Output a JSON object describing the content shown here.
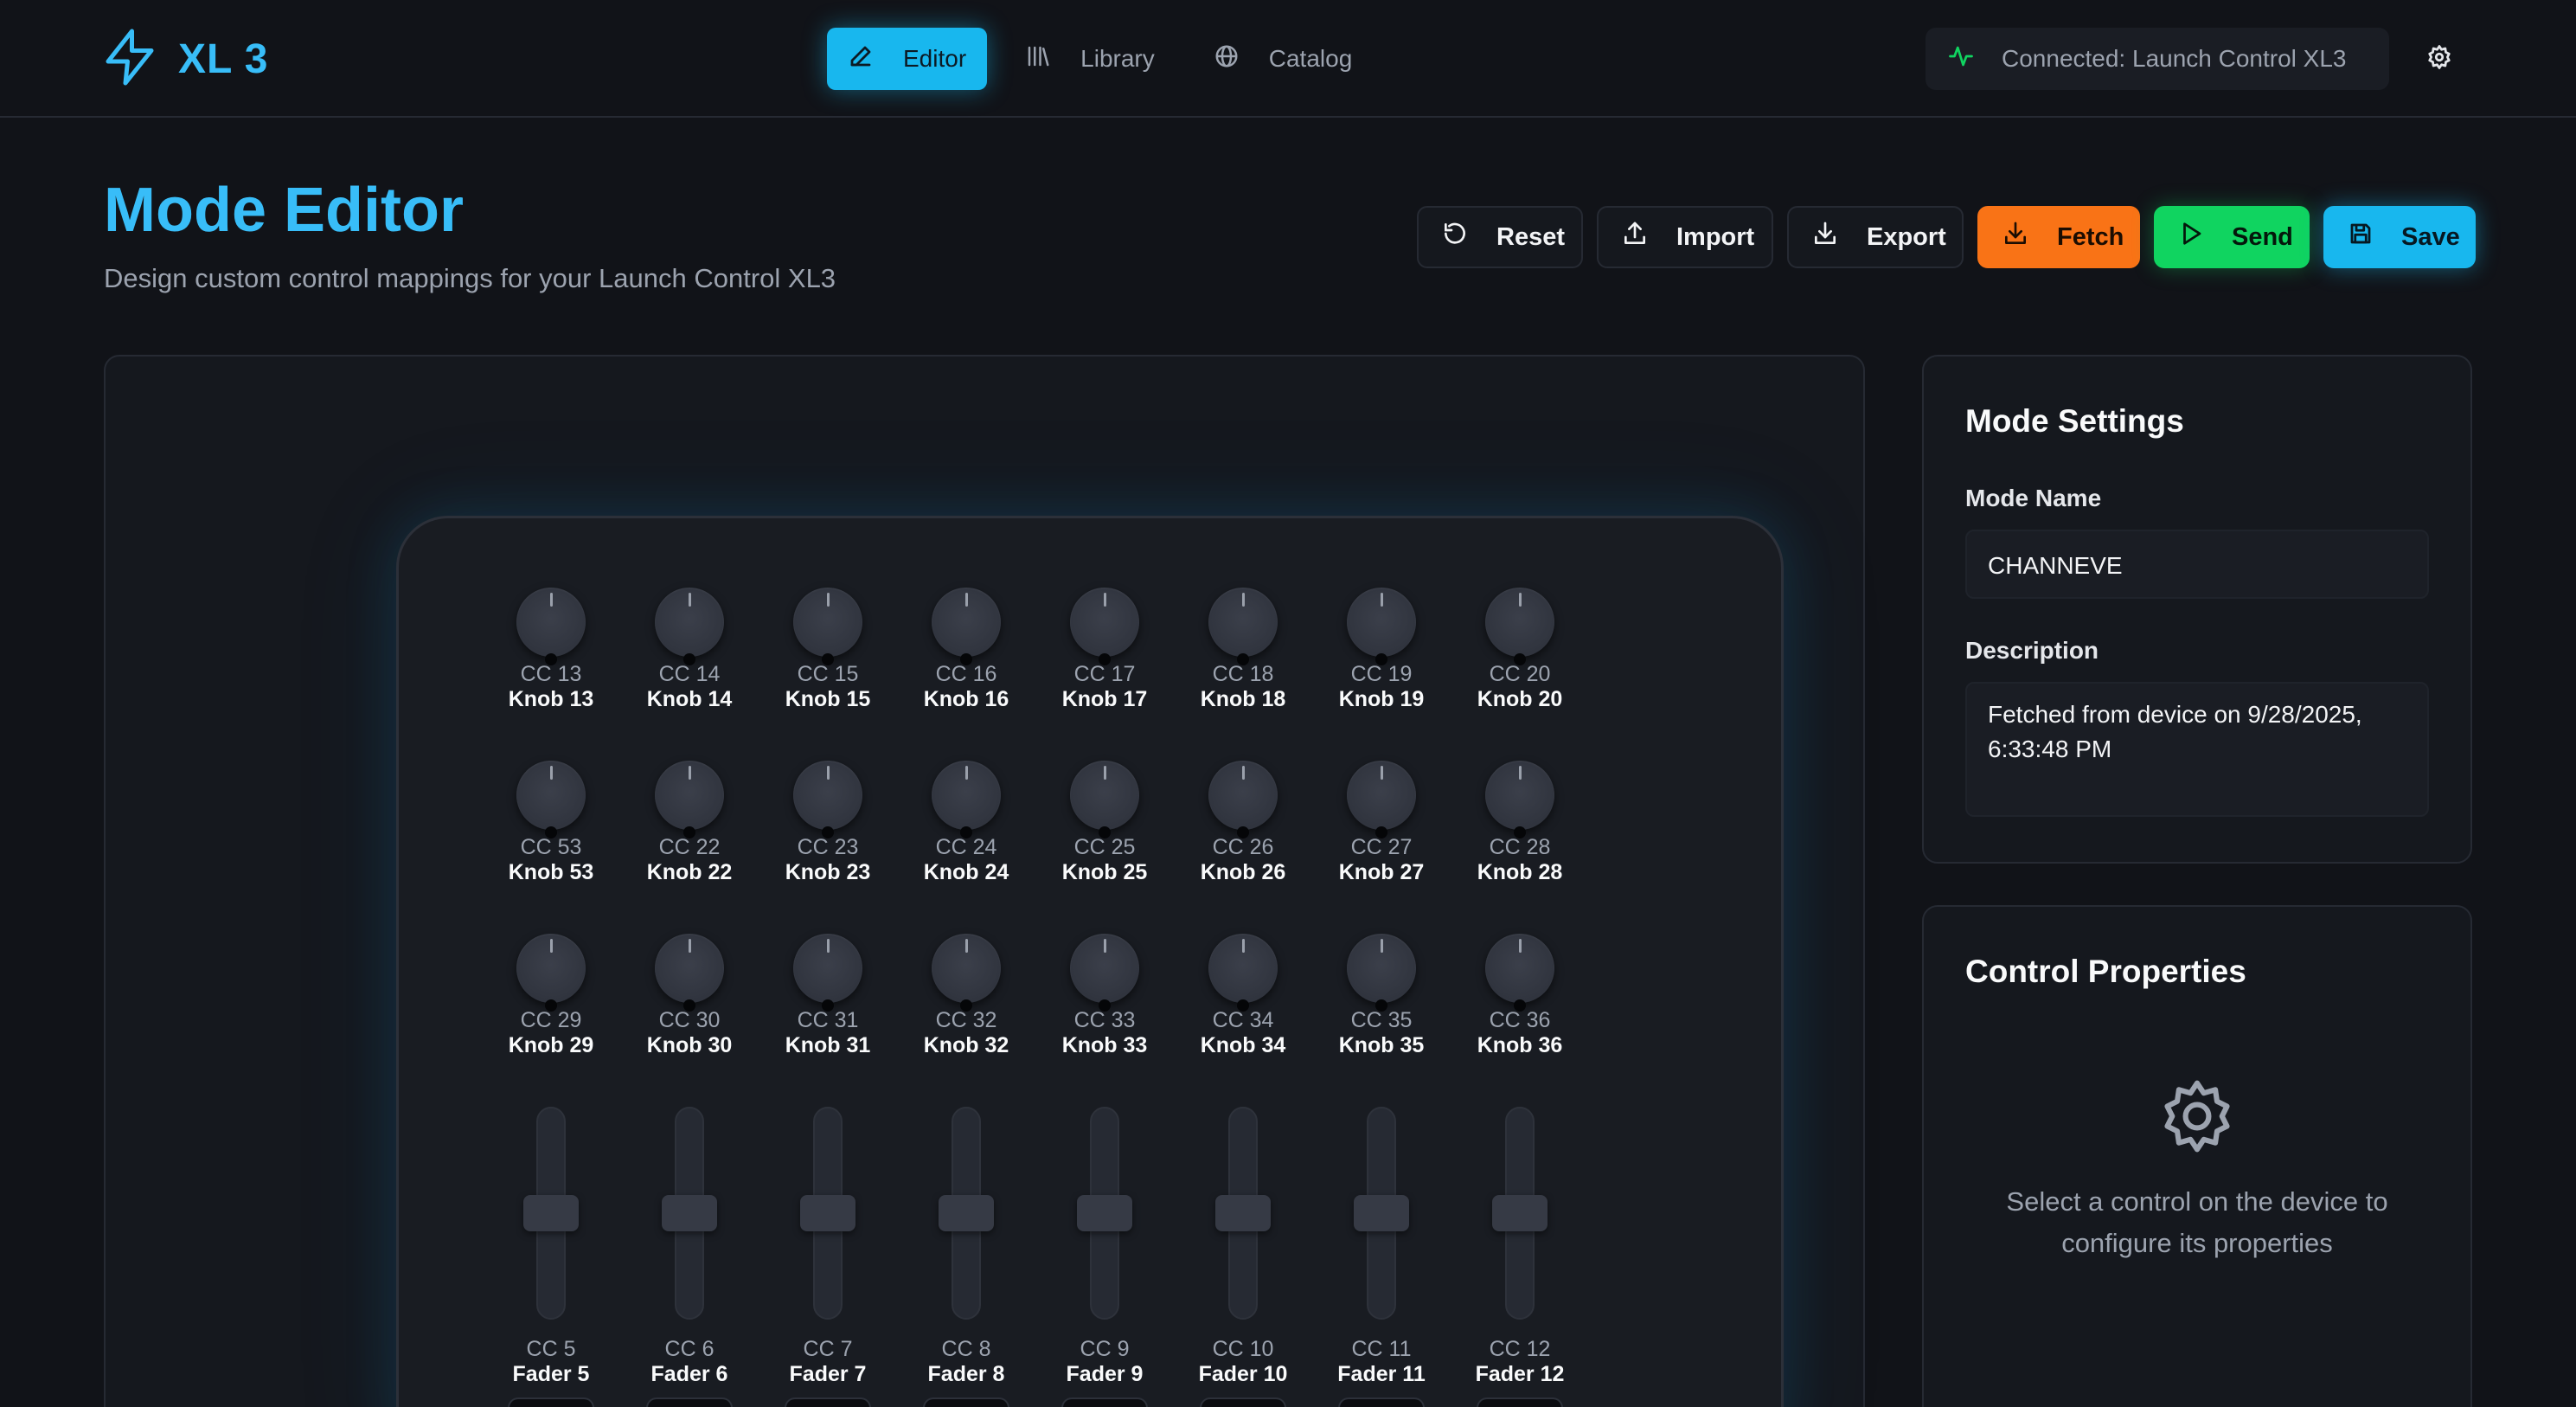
{
  "app": {
    "logo_text": "XL 3",
    "accent_color": "#38bdf8"
  },
  "nav": {
    "items": [
      {
        "label": "Editor",
        "icon": "pencil-icon",
        "active": true
      },
      {
        "label": "Library",
        "icon": "library-icon",
        "active": false
      },
      {
        "label": "Catalog",
        "icon": "globe-icon",
        "active": false
      }
    ]
  },
  "status": {
    "text": "Connected: Launch Control XL3",
    "icon": "activity-icon",
    "color": "#10d460"
  },
  "page": {
    "title": "Mode Editor",
    "subtitle": "Design custom control mappings for your Launch Control XL3"
  },
  "toolbar": {
    "reset_label": "Reset",
    "import_label": "Import",
    "export_label": "Export",
    "fetch_label": "Fetch",
    "send_label": "Send",
    "save_label": "Save"
  },
  "device": {
    "knob_rows": [
      [
        {
          "cc": "CC 13",
          "name": "Knob 13"
        },
        {
          "cc": "CC 14",
          "name": "Knob 14"
        },
        {
          "cc": "CC 15",
          "name": "Knob 15"
        },
        {
          "cc": "CC 16",
          "name": "Knob 16"
        },
        {
          "cc": "CC 17",
          "name": "Knob 17"
        },
        {
          "cc": "CC 18",
          "name": "Knob 18"
        },
        {
          "cc": "CC 19",
          "name": "Knob 19"
        },
        {
          "cc": "CC 20",
          "name": "Knob 20"
        }
      ],
      [
        {
          "cc": "CC 53",
          "name": "Knob 53"
        },
        {
          "cc": "CC 22",
          "name": "Knob 22"
        },
        {
          "cc": "CC 23",
          "name": "Knob 23"
        },
        {
          "cc": "CC 24",
          "name": "Knob 24"
        },
        {
          "cc": "CC 25",
          "name": "Knob 25"
        },
        {
          "cc": "CC 26",
          "name": "Knob 26"
        },
        {
          "cc": "CC 27",
          "name": "Knob 27"
        },
        {
          "cc": "CC 28",
          "name": "Knob 28"
        }
      ],
      [
        {
          "cc": "CC 29",
          "name": "Knob 29"
        },
        {
          "cc": "CC 30",
          "name": "Knob 30"
        },
        {
          "cc": "CC 31",
          "name": "Knob 31"
        },
        {
          "cc": "CC 32",
          "name": "Knob 32"
        },
        {
          "cc": "CC 33",
          "name": "Knob 33"
        },
        {
          "cc": "CC 34",
          "name": "Knob 34"
        },
        {
          "cc": "CC 35",
          "name": "Knob 35"
        },
        {
          "cc": "CC 36",
          "name": "Knob 36"
        }
      ]
    ],
    "faders": [
      {
        "cc": "CC 5",
        "name": "Fader 5"
      },
      {
        "cc": "CC 6",
        "name": "Fader 6"
      },
      {
        "cc": "CC 7",
        "name": "Fader 7"
      },
      {
        "cc": "CC 8",
        "name": "Fader 8"
      },
      {
        "cc": "CC 9",
        "name": "Fader 9"
      },
      {
        "cc": "CC 10",
        "name": "Fader 10"
      },
      {
        "cc": "CC 11",
        "name": "Fader 11"
      },
      {
        "cc": "CC 12",
        "name": "Fader 12"
      }
    ]
  },
  "settings": {
    "title": "Mode Settings",
    "mode_name_label": "Mode Name",
    "mode_name_value": "CHANNEVE",
    "description_label": "Description",
    "description_value": "Fetched from device on 9/28/2025, 6:33:48 PM"
  },
  "properties": {
    "title": "Control Properties",
    "empty_icon": "gear-icon",
    "empty_text": "Select a control on the device to configure its properties"
  }
}
